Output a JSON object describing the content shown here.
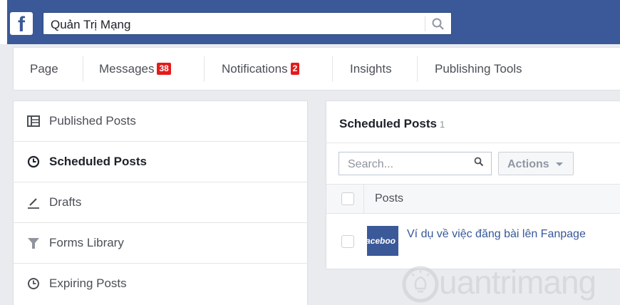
{
  "topbar": {
    "logo": "f",
    "search_value": "Quản Trị Mạng",
    "search_icon": "search-icon",
    "bg_color": "#3b5998"
  },
  "pagenav": {
    "items": [
      {
        "label": "Page"
      },
      {
        "label": "Messages",
        "badge": "38"
      },
      {
        "label": "Notifications",
        "badge": "2"
      },
      {
        "label": "Insights"
      },
      {
        "label": "Publishing Tools"
      }
    ],
    "badge_color": "#e41b1b"
  },
  "sidebar": {
    "items": [
      {
        "label": "Published Posts",
        "icon": "list-icon"
      },
      {
        "label": "Scheduled Posts",
        "icon": "clock-icon",
        "active": true
      },
      {
        "label": "Drafts",
        "icon": "pencil-icon"
      },
      {
        "label": "Forms Library",
        "icon": "filter-icon"
      },
      {
        "label": "Expiring Posts",
        "icon": "clock-icon"
      }
    ]
  },
  "main": {
    "title": "Scheduled Posts",
    "count": "1",
    "search_placeholder": "Search...",
    "actions_label": "Actions",
    "column_posts": "Posts",
    "rows": [
      {
        "title": "Ví dụ về việc đăng bài lên Fanpage",
        "thumb_text": "aceboo"
      }
    ]
  },
  "watermark": {
    "text": "uantrimang"
  }
}
